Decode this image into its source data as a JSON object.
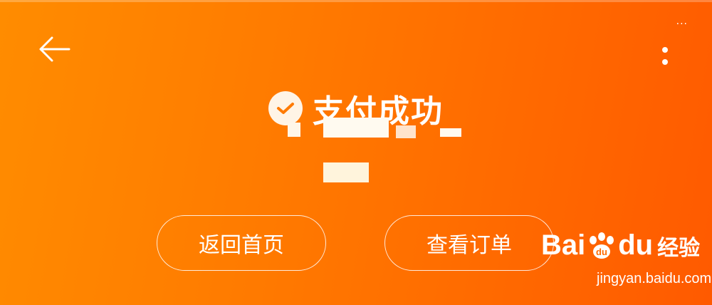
{
  "status_bar": {
    "dots": "···"
  },
  "header": {
    "back_icon": "arrow-left-icon",
    "more_icon": "more-vertical-icon"
  },
  "result": {
    "icon": "check-circle-icon",
    "title": "支付成功"
  },
  "actions": {
    "home_label": "返回首页",
    "order_label": "查看订单"
  },
  "watermark": {
    "brand_part1": "Bai",
    "brand_part2": "du",
    "brand_cn": "经验",
    "url": "jingyan.baidu.com"
  },
  "colors": {
    "gradient_start": "#ff8c00",
    "gradient_end": "#ff5a00",
    "check_icon": "#ff7a00",
    "text": "#ffffff"
  }
}
